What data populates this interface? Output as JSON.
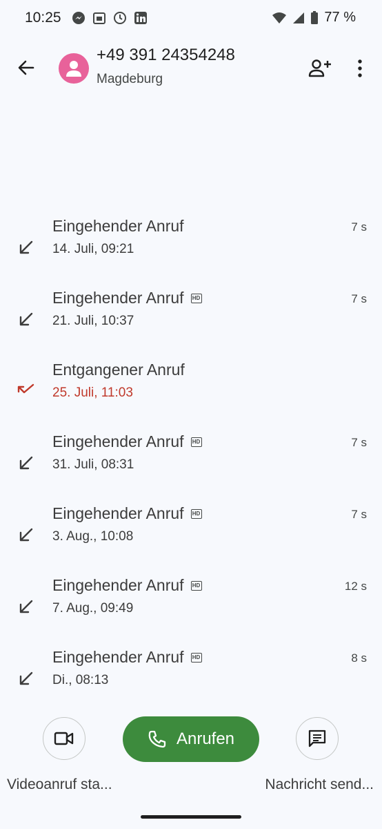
{
  "status_bar": {
    "time": "10:25",
    "battery_percent": "77 %",
    "left_icons": [
      "messenger-icon",
      "calendar-31-icon",
      "history-icon",
      "linkedin-icon"
    ],
    "right_icons": [
      "wifi-icon",
      "signal-icon",
      "battery-icon"
    ]
  },
  "contact": {
    "number": "+49 391 24354248",
    "location": "Magdeburg"
  },
  "calls": [
    {
      "type": "Eingehender Anruf",
      "date": "14. Juli, 09:21",
      "duration": "7 s",
      "hd": false,
      "missed": false
    },
    {
      "type": "Eingehender Anruf",
      "date": "21. Juli, 10:37",
      "duration": "7 s",
      "hd": true,
      "missed": false
    },
    {
      "type": "Entgangener Anruf",
      "date": "25. Juli, 11:03",
      "duration": "",
      "hd": false,
      "missed": true
    },
    {
      "type": "Eingehender Anruf",
      "date": "31. Juli, 08:31",
      "duration": "7 s",
      "hd": true,
      "missed": false
    },
    {
      "type": "Eingehender Anruf",
      "date": "3. Aug., 10:08",
      "duration": "7 s",
      "hd": true,
      "missed": false
    },
    {
      "type": "Eingehender Anruf",
      "date": "7. Aug., 09:49",
      "duration": "12 s",
      "hd": true,
      "missed": false
    },
    {
      "type": "Eingehender Anruf",
      "date": "Di., 08:13",
      "duration": "8 s",
      "hd": true,
      "missed": false
    }
  ],
  "hd_badge": "HD",
  "actions": {
    "call_label": "Anrufen",
    "video_label": "Videoanruf sta...",
    "message_label": "Nachricht send..."
  },
  "colors": {
    "accent_green": "#3d8b3d",
    "missed_red": "#c0392b",
    "avatar_pink": "#e8629a"
  }
}
